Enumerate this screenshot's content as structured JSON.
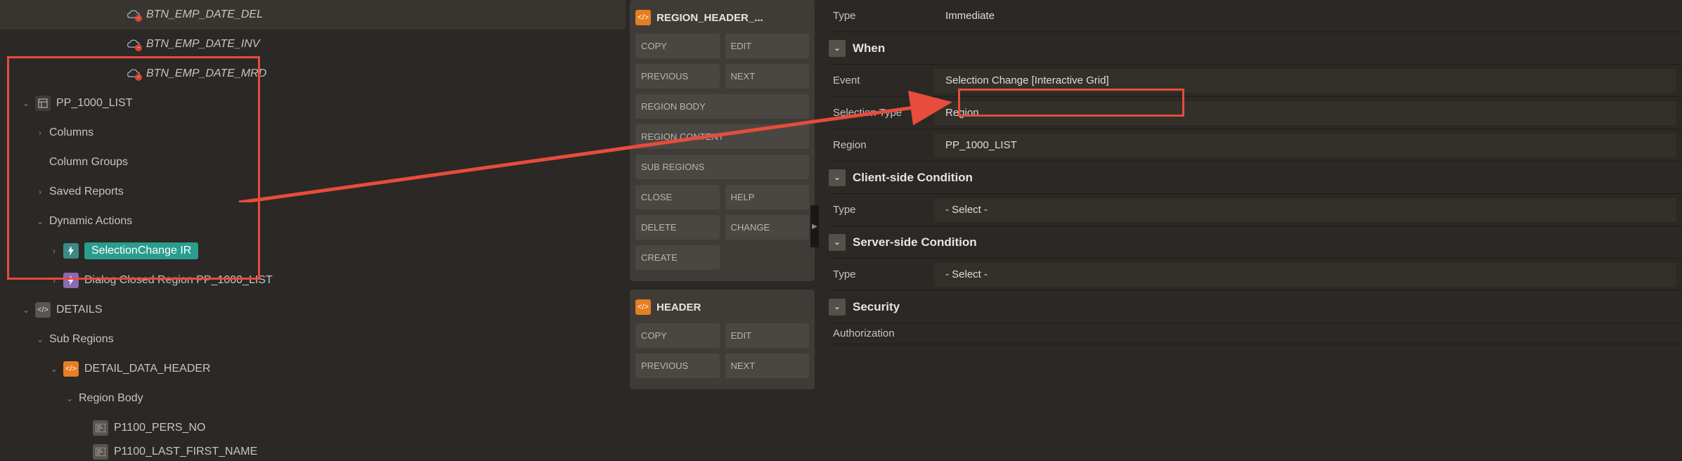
{
  "tree": {
    "buttons": [
      {
        "label": "BTN_EMP_DATE_DEL"
      },
      {
        "label": "BTN_EMP_DATE_INV"
      },
      {
        "label": "BTN_EMP_DATE_MRD"
      }
    ],
    "region": {
      "name": "PP_1000_LIST",
      "children": [
        {
          "label": "Columns"
        },
        {
          "label": "Column Groups"
        },
        {
          "label": "Saved Reports"
        },
        {
          "label": "Dynamic Actions"
        }
      ],
      "dynamic_actions": [
        {
          "label": "SelectionChange IR",
          "selected": true
        },
        {
          "label": "Dialog Closed Region PP_1000_LIST"
        }
      ]
    },
    "details": "DETAILS",
    "sub_regions": "Sub Regions",
    "detail_header": "DETAIL_DATA_HEADER",
    "region_body": "Region Body",
    "items": [
      {
        "label": "P1100_PERS_NO"
      },
      {
        "label": "P1100_LAST_FIRST_NAME"
      }
    ]
  },
  "gallery": {
    "card1": {
      "title": "REGION_HEADER_...",
      "buttons": [
        "COPY",
        "EDIT",
        "PREVIOUS",
        "NEXT",
        "REGION BODY",
        "REGION CONTENT",
        "SUB REGIONS",
        "CLOSE",
        "HELP",
        "DELETE",
        "CHANGE",
        "CREATE"
      ]
    },
    "card2": {
      "title": "HEADER",
      "buttons": [
        "COPY",
        "EDIT",
        "PREVIOUS",
        "NEXT"
      ]
    }
  },
  "props": {
    "type_label": "Type",
    "type_value": "Immediate",
    "when_section": "When",
    "event_label": "Event",
    "event_value": "Selection Change [Interactive Grid]",
    "seltype_label": "Selection Type",
    "seltype_value": "Region",
    "region_label": "Region",
    "region_value": "PP_1000_LIST",
    "client_section": "Client-side Condition",
    "client_type_label": "Type",
    "client_type_value": "- Select -",
    "server_section": "Server-side Condition",
    "server_type_label": "Type",
    "server_type_value": "- Select -",
    "security_section": "Security",
    "auth_label": "Authorization"
  }
}
